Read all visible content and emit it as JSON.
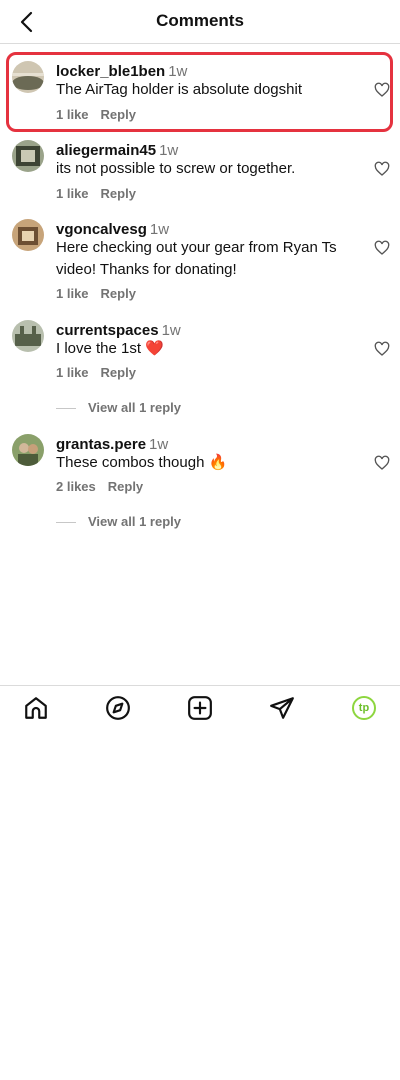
{
  "header": {
    "title": "Comments",
    "back_icon": "chevron-left-icon"
  },
  "comments": [
    {
      "username": "locker_ble1ben",
      "time": "1w",
      "text": "The AirTag holder is absolute dogshit",
      "likes": "1 like",
      "reply": "Reply",
      "avatar_colors": [
        "#cfc6b2",
        "#6b6a55"
      ]
    },
    {
      "username": "aliegermain45",
      "time": "1w",
      "text": "its not possible to screw or together.",
      "likes": "1 like",
      "reply": "Reply",
      "avatar_colors": [
        "#9aa38a",
        "#3d4434"
      ]
    },
    {
      "username": "vgoncalvesg",
      "time": "1w",
      "text": "Here checking out your gear from Ryan Ts video! Thanks for donating!",
      "likes": "1 like",
      "reply": "Reply",
      "avatar_colors": [
        "#c7a47a",
        "#6d4f33"
      ]
    },
    {
      "username": "currentspaces",
      "time": "1w",
      "text": "I love the 1st ❤️",
      "likes": "1 like",
      "reply": "Reply",
      "view_replies": "View all 1 reply",
      "avatar_colors": [
        "#b8bfae",
        "#56604a"
      ]
    },
    {
      "username": "grantas.pere",
      "time": "1w",
      "text": "These combos though 🔥",
      "likes": "2 likes",
      "reply": "Reply",
      "view_replies": "View all 1 reply",
      "avatar_colors": [
        "#8aa06a",
        "#4d5c3a"
      ]
    }
  ],
  "tabbar": {
    "icons": [
      "home-icon",
      "explore-compass-icon",
      "new-post-icon",
      "direct-message-icon"
    ],
    "profile_initials": "tp",
    "profile_color": "#8dd63f"
  },
  "colors": {
    "highlight": "#e5323f",
    "muted": "#737373"
  }
}
